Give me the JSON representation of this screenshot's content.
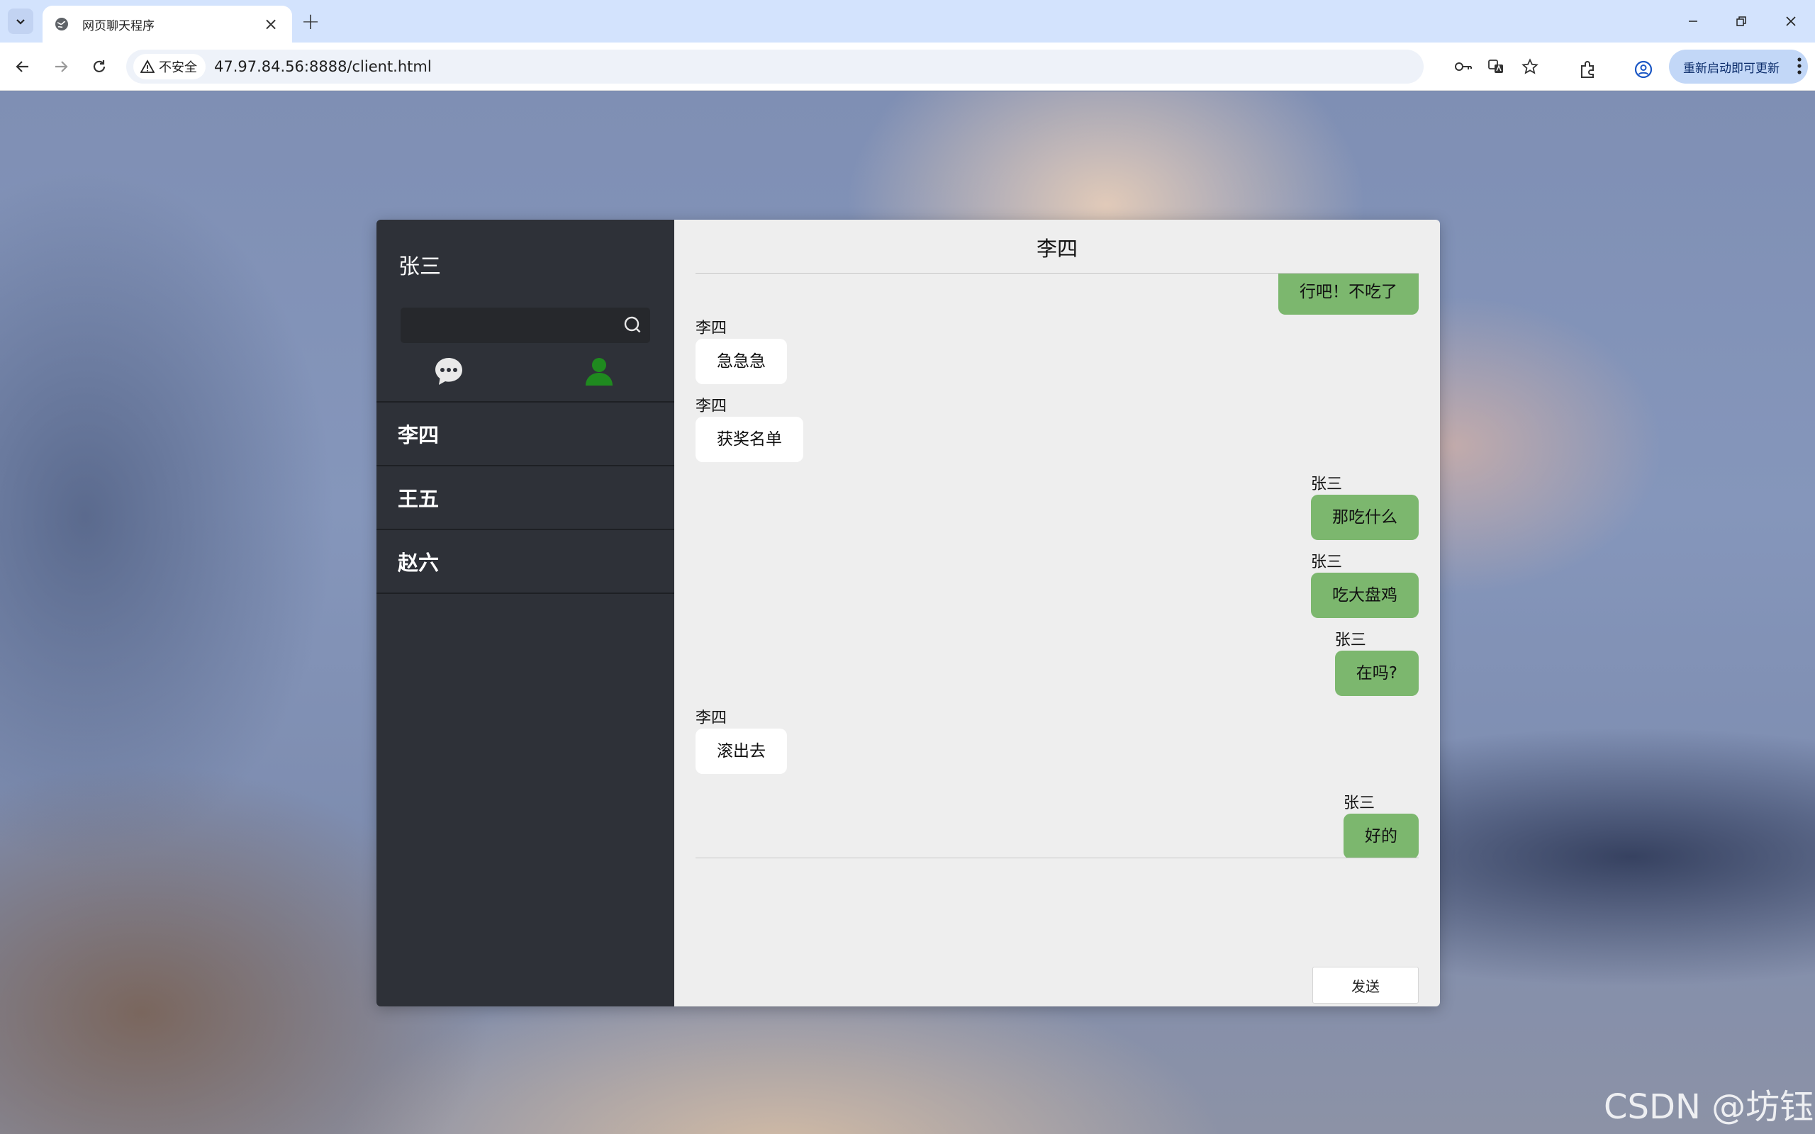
{
  "browser": {
    "tab_title": "网页聊天程序",
    "security_label": "不安全",
    "url": "47.97.84.56:8888/client.html",
    "update_label": "重新启动即可更新"
  },
  "chat": {
    "current_user": "张三",
    "search_placeholder": "",
    "peer": "李四",
    "contacts": [
      {
        "name": "李四"
      },
      {
        "name": "王五"
      },
      {
        "name": "赵六"
      }
    ],
    "messages": [
      {
        "sender": "",
        "text": "行吧！不吃了",
        "direction": "out"
      },
      {
        "sender": "李四",
        "text": "急急急",
        "direction": "in"
      },
      {
        "sender": "李四",
        "text": "获奖名单",
        "direction": "in"
      },
      {
        "sender": "张三",
        "text": "那吃什么",
        "direction": "out"
      },
      {
        "sender": "张三",
        "text": "吃大盘鸡",
        "direction": "out"
      },
      {
        "sender": "张三",
        "text": "在吗?",
        "direction": "out"
      },
      {
        "sender": "李四",
        "text": "滚出去",
        "direction": "in"
      },
      {
        "sender": "张三",
        "text": "好的",
        "direction": "out"
      }
    ],
    "send_label": "发送"
  },
  "colors": {
    "sidebar": "#2e3138",
    "outgoing_bubble": "#7cb76e",
    "incoming_bubble": "#ffffff",
    "contact_icon": "#1f8a1f"
  },
  "watermark": "CSDN @坊钰"
}
